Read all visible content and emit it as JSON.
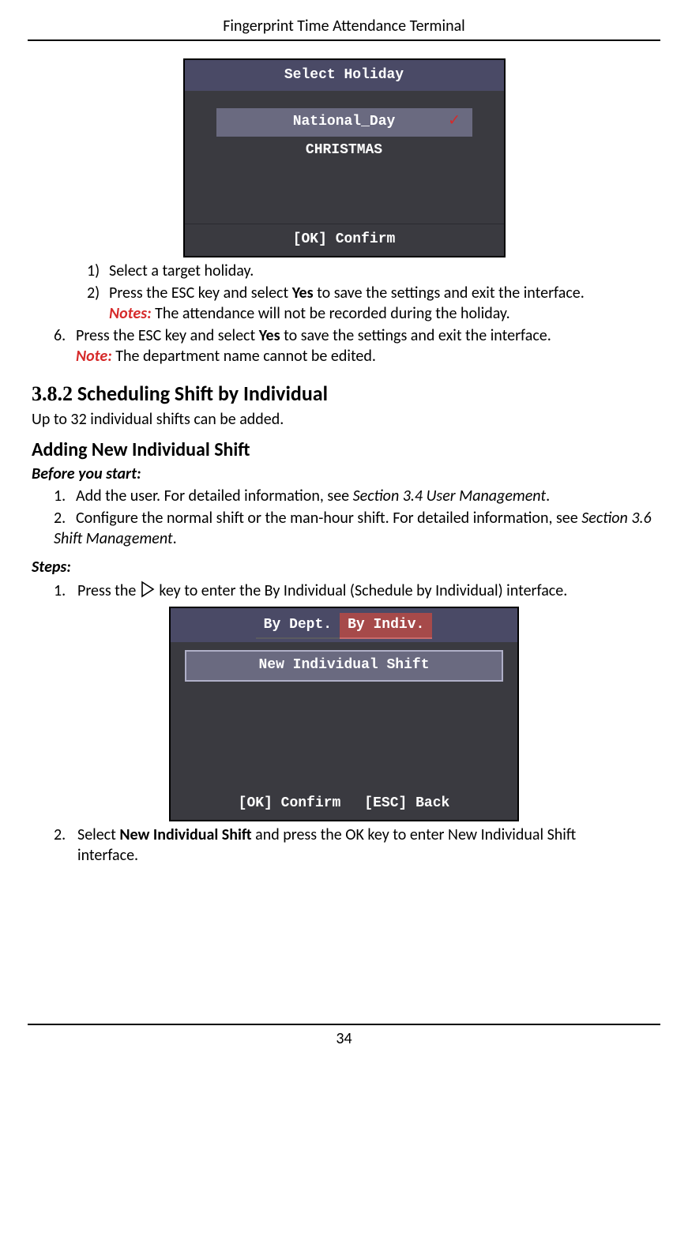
{
  "header": "Fingerprint Time Attendance Terminal",
  "screenshot1": {
    "title": "Select Holiday",
    "item_selected": "National_Day",
    "item2": "CHRISTMAS",
    "footer": "[OK] Confirm"
  },
  "list_a": {
    "i1_num": "1)",
    "i1_text": "Select a target holiday.",
    "i2_num": "2)",
    "i2_text_a": "Press the ESC key and select ",
    "i2_bold": "Yes",
    "i2_text_b": " to save the settings and exit the interface.",
    "i2_notes_label": "Notes:",
    "i2_notes_text": " The attendance will not be recorded during the holiday."
  },
  "list_b": {
    "i6_num": "6.",
    "i6_text_a": "Press the ESC key and select ",
    "i6_bold": "Yes",
    "i6_text_b": " to save the settings and exit the interface.",
    "i6_note_label": "Note:",
    "i6_note_text": " The department name cannot be edited."
  },
  "h382_num": "3.8.2",
  "h382_title": " Scheduling Shift by Individual",
  "intro": "Up to 32 individual shifts can be added.",
  "h_adding": "Adding New Individual Shift",
  "bys": "Before you start:",
  "bys_list": {
    "i1_num": "1.",
    "i1_text_a": "Add the user. For detailed information, see ",
    "i1_italic": "Section 3.4 User Management",
    "i1_text_b": ".",
    "i2_num": "2.",
    "i2_text_a": "Configure the normal shift or the man-hour shift. For detailed information, see ",
    "i2_italic": "Section 3.6 Shift Management",
    "i2_text_b": "."
  },
  "steps_label": "Steps:",
  "step1": {
    "num": "1.",
    "text_a": "Press the ",
    "text_b": " key to enter the By Individual (Schedule by Individual) interface."
  },
  "screenshot2": {
    "tab1": "By Dept.",
    "tab2": "By Indiv.",
    "item": "New Individual Shift",
    "footer_ok": "[OK] Confirm",
    "footer_esc": "[ESC] Back"
  },
  "step2": {
    "num": "2.",
    "text_a": "Select ",
    "bold": "New Individual Shift",
    "text_b": " and press the OK key to enter New Individual Shift",
    "cont": "interface."
  },
  "page_number": "34"
}
